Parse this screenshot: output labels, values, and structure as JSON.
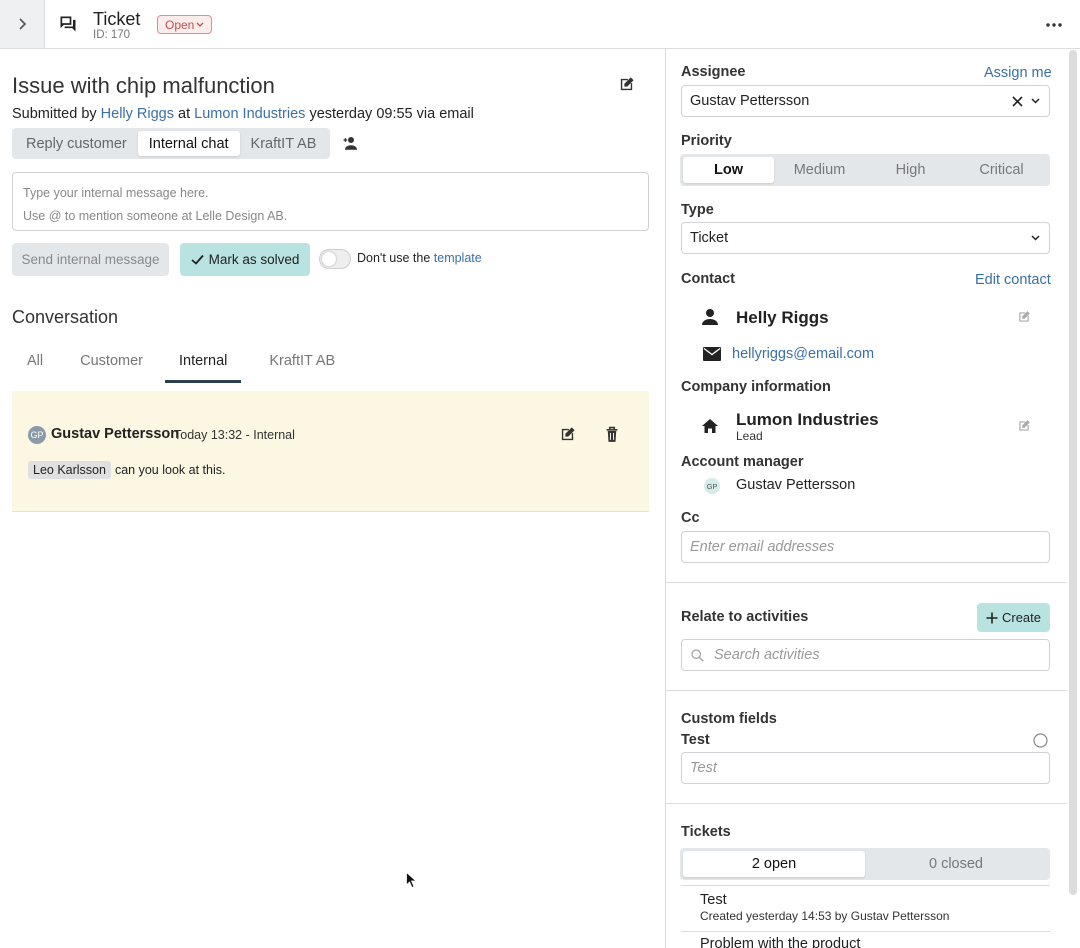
{
  "header": {
    "title": "Ticket",
    "id": "ID: 170",
    "status": "Open"
  },
  "ticket": {
    "subject": "Issue with chip malfunction",
    "submitted": {
      "prefix": "Submitted by",
      "submitter": "Helly Riggs",
      "at": "at",
      "company": "Lumon Industries",
      "suffix": "yesterday 09:55 via email"
    }
  },
  "reply_tabs": [
    {
      "label": "Reply customer"
    },
    {
      "label": "Internal chat"
    },
    {
      "label": "KraftIT AB"
    }
  ],
  "composer": {
    "line1": "Type your internal message here.",
    "line2": "Use @ to mention someone at Lelle Design AB.",
    "send_label": "Send internal message",
    "solve_label": "Mark as solved",
    "template_prefix": "Don't use the",
    "template_link": "template"
  },
  "conversation": {
    "title": "Conversation",
    "tabs": [
      {
        "label": "All"
      },
      {
        "label": "Customer"
      },
      {
        "label": "Internal"
      },
      {
        "label": "KraftIT AB"
      }
    ],
    "messages": [
      {
        "initials": "GP",
        "author": "Gustav Pettersson",
        "meta": "Today 13:32 - Internal",
        "mention": "Leo Karlsson",
        "text": "can you look at this."
      }
    ]
  },
  "sidebar": {
    "assignee": {
      "label": "Assignee",
      "action": "Assign me",
      "value": "Gustav Pettersson"
    },
    "priority": {
      "label": "Priority",
      "options": [
        "Low",
        "Medium",
        "High",
        "Critical"
      ],
      "selected": "Low"
    },
    "type": {
      "label": "Type",
      "value": "Ticket"
    },
    "contact": {
      "label": "Contact",
      "action": "Edit contact",
      "name": "Helly Riggs",
      "email": "hellyriggs@email.com"
    },
    "company": {
      "label": "Company information",
      "name": "Lumon Industries",
      "status": "Lead"
    },
    "account_manager": {
      "label": "Account manager",
      "initials": "GP",
      "name": "Gustav Pettersson"
    },
    "cc": {
      "label": "Cc",
      "placeholder": "Enter email addresses"
    },
    "activities": {
      "label": "Relate to activities",
      "create_label": "Create",
      "search_placeholder": "Search activities"
    },
    "custom_fields": {
      "label": "Custom fields",
      "field_label": "Test",
      "field_placeholder": "Test"
    },
    "tickets": {
      "label": "Tickets",
      "open_label": "2 open",
      "closed_label": "0 closed",
      "items": [
        {
          "title": "Test",
          "subtitle": "Created yesterday 14:53 by Gustav Pettersson"
        },
        {
          "title": "Problem with the product",
          "subtitle": ""
        }
      ]
    }
  }
}
